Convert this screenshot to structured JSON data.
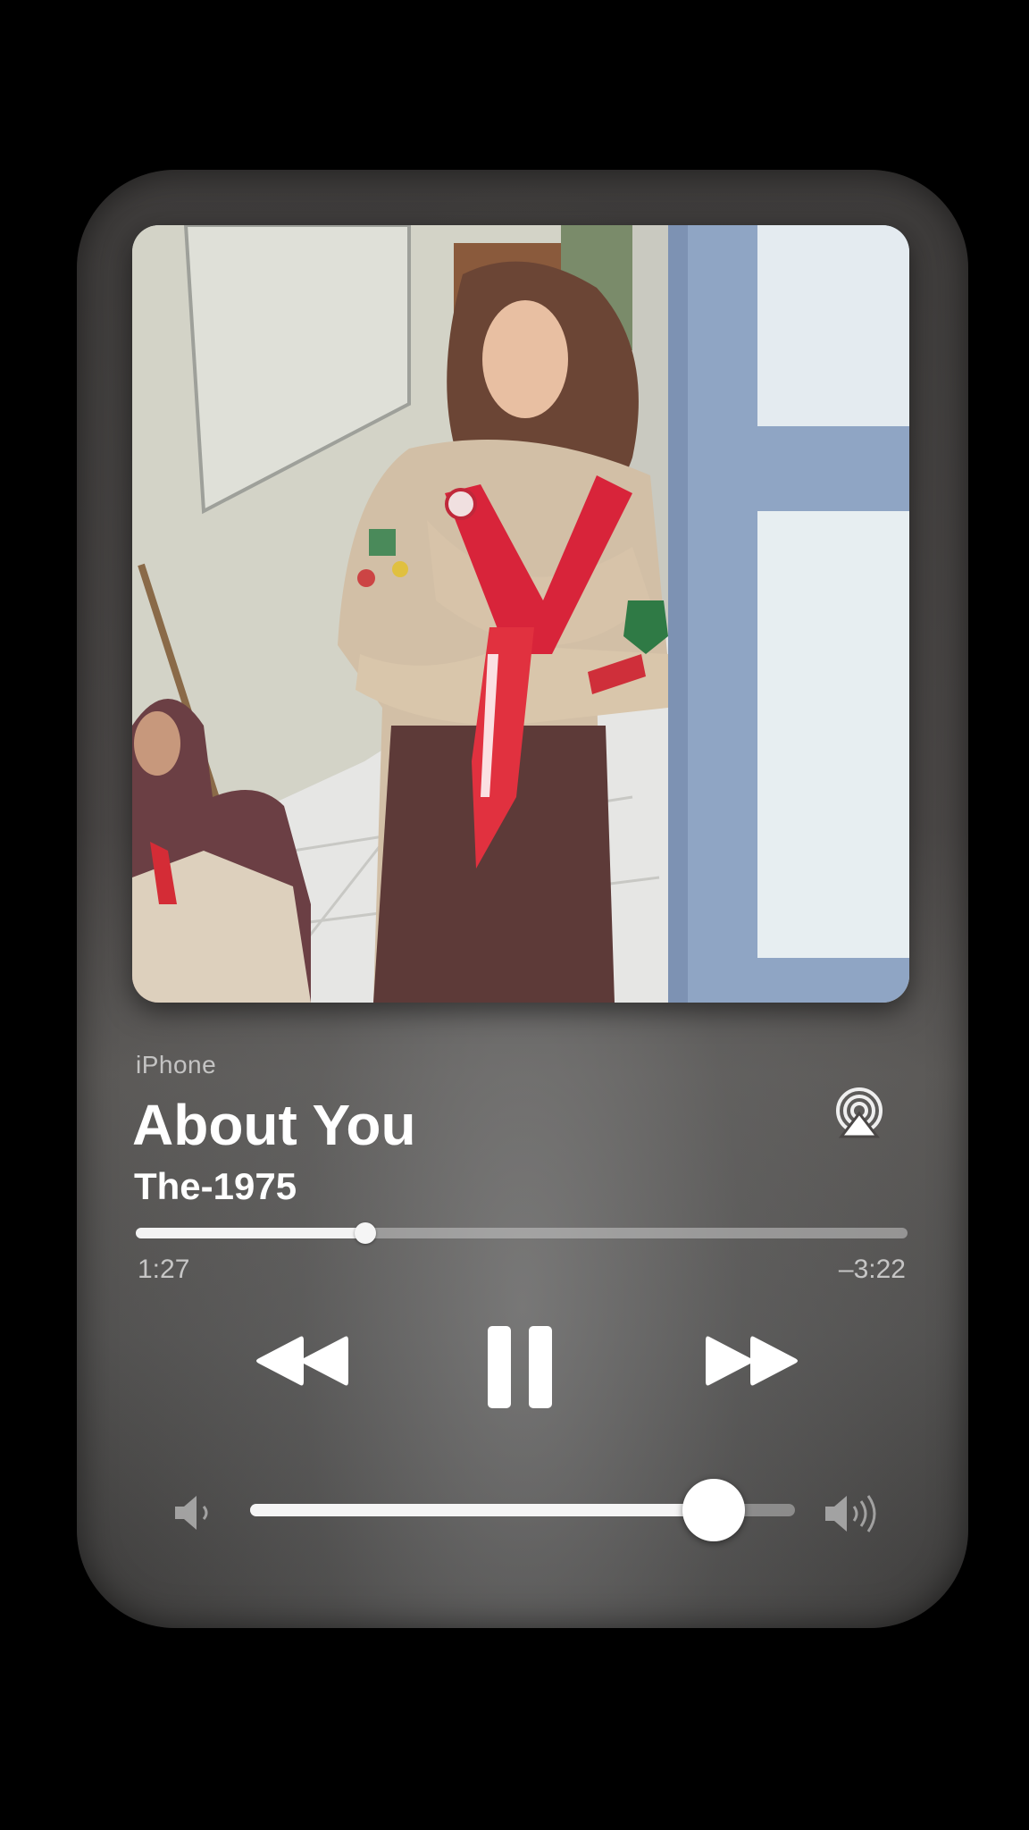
{
  "player": {
    "source_label": "iPhone",
    "track_title": "About You",
    "artist": "The-1975",
    "elapsed": "1:27",
    "remaining": "–3:22",
    "progress_fraction": 0.298,
    "volume_fraction": 0.85
  },
  "icons": {
    "airplay": "airplay-icon",
    "rewind": "rewind-icon",
    "pause": "pause-icon",
    "forward": "fast-forward-icon",
    "volume_low": "volume-low-icon",
    "volume_high": "volume-high-icon"
  },
  "colors": {
    "background": "#000000",
    "card": "#4a4746",
    "text": "#ffffff",
    "muted_text": "#d8d8d8"
  }
}
